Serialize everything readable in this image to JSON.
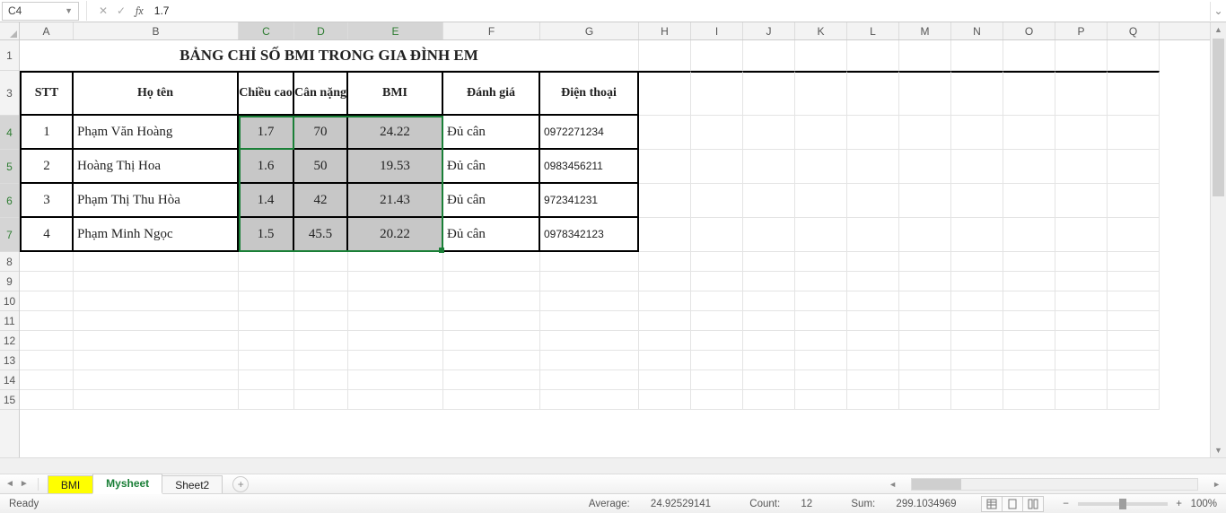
{
  "formula_bar": {
    "cell_ref": "C4",
    "fx": "fx",
    "value": "1.7"
  },
  "columns": [
    "A",
    "B",
    "C",
    "D",
    "E",
    "F",
    "G",
    "H",
    "I",
    "J",
    "K",
    "L",
    "M",
    "N",
    "O",
    "P",
    "Q"
  ],
  "selected_columns": [
    "C",
    "D",
    "E"
  ],
  "row_labels": [
    "1",
    "2",
    "3",
    "4",
    "5",
    "6",
    "7",
    "8",
    "9",
    "10",
    "11",
    "12",
    "13",
    "14",
    "15"
  ],
  "selected_rows": [
    "4",
    "5",
    "6",
    "7"
  ],
  "table": {
    "title": "BẢNG CHỈ SỐ BMI TRONG GIA ĐÌNH EM",
    "headers": {
      "stt": "STT",
      "name": "Họ tên",
      "height": "Chiều cao",
      "weight": "Cân nặng",
      "bmi": "BMI",
      "eval": "Đánh giá",
      "phone": "Điện thoại"
    },
    "rows": [
      {
        "stt": "1",
        "name": "Phạm Văn Hoàng",
        "height": "1.7",
        "weight": "70",
        "bmi": "24.22",
        "eval": "Đủ cân",
        "phone": "0972271234"
      },
      {
        "stt": "2",
        "name": "Hoàng Thị Hoa",
        "height": "1.6",
        "weight": "50",
        "bmi": "19.53",
        "eval": "Đủ cân",
        "phone": "0983456211"
      },
      {
        "stt": "3",
        "name": "Phạm  Thị Thu Hòa",
        "height": "1.4",
        "weight": "42",
        "bmi": "21.43",
        "eval": "Đủ cân",
        "phone": "972341231"
      },
      {
        "stt": "4",
        "name": "Phạm Minh Ngọc",
        "height": "1.5",
        "weight": "45.5",
        "bmi": "20.22",
        "eval": "Đủ cân",
        "phone": "0978342123"
      }
    ]
  },
  "tabs": {
    "bmi": "BMI",
    "mysheet": "Mysheet",
    "sheet2": "Sheet2"
  },
  "status": {
    "ready": "Ready",
    "avg_label": "Average:",
    "avg": "24.92529141",
    "count_label": "Count:",
    "count": "12",
    "sum_label": "Sum:",
    "sum": "299.1034969",
    "zoom": "100%"
  }
}
